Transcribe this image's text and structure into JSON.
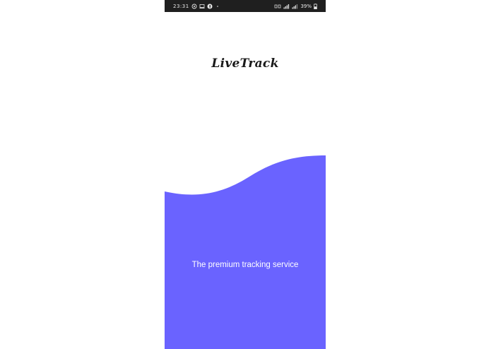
{
  "status_bar": {
    "time": "23:31",
    "left_icons": [
      "whatsapp-icon",
      "screen-icon",
      "facebook-icon",
      "dot-icon"
    ],
    "network_label": "Vo LTE",
    "battery": "39%"
  },
  "app": {
    "logo_text": "LiveTrack",
    "tagline": "The premium tracking service",
    "accent_color": "#6a63ff"
  }
}
